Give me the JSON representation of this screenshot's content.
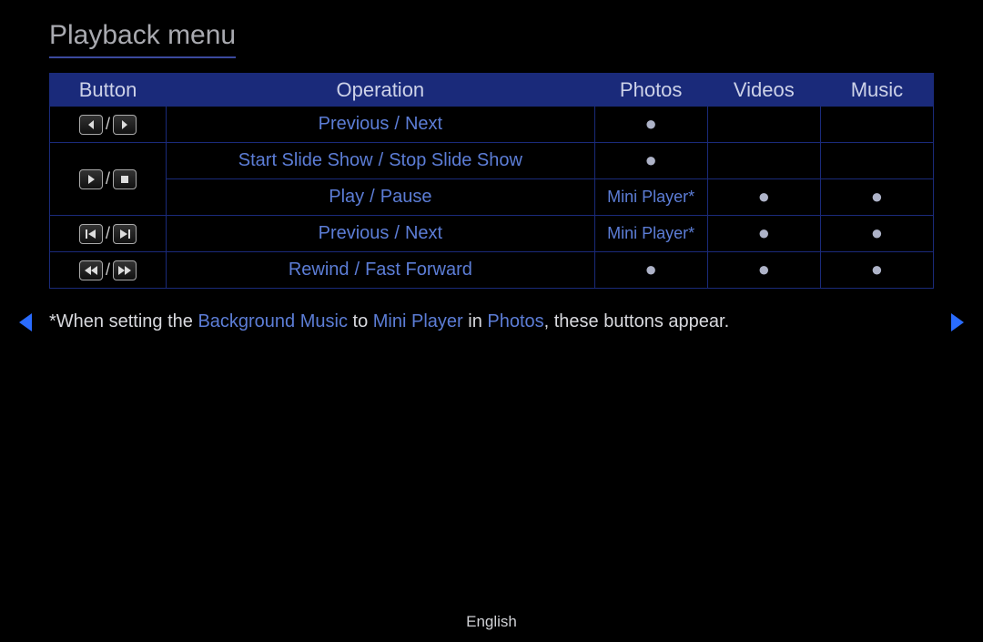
{
  "title": "Playback menu",
  "headers": {
    "button": "Button",
    "operation": "Operation",
    "photos": "Photos",
    "videos": "Videos",
    "music": "Music"
  },
  "rows": [
    {
      "icons": [
        "chevron-left",
        "chevron-right"
      ],
      "sep": "/",
      "op_a": "Previous",
      "op_b": "Next",
      "slash": "/",
      "photos": "●",
      "videos": "",
      "music": ""
    },
    {
      "icons": [
        "play",
        "stop"
      ],
      "sep": "/",
      "op_a": "Start Slide Show",
      "op_b": "Stop Slide Show",
      "slash": "/",
      "photos": "●",
      "videos": "",
      "music": ""
    },
    {
      "icons": [],
      "sep": "",
      "op_a": "Play",
      "op_b": "Pause",
      "slash": "/",
      "photos_text": "Mini Player*",
      "videos": "●",
      "music": "●"
    },
    {
      "icons": [
        "skip-prev",
        "skip-next"
      ],
      "sep": "/",
      "op_a": "Previous",
      "op_b": "Next",
      "slash": "/",
      "photos_text": "Mini Player*",
      "videos": "●",
      "music": "●"
    },
    {
      "icons": [
        "rewind",
        "fast-forward"
      ],
      "sep": "/",
      "op_a": "Rewind",
      "op_b": "Fast Forward",
      "slash": "/",
      "photos": "●",
      "videos": "●",
      "music": "●"
    }
  ],
  "note": {
    "t1": "*When setting the ",
    "k1": "Background Music",
    "t2": " to ",
    "k2": "Mini Player",
    "t3": " in ",
    "k3": "Photos",
    "t4": ", these buttons appear."
  },
  "footer_lang": "English"
}
